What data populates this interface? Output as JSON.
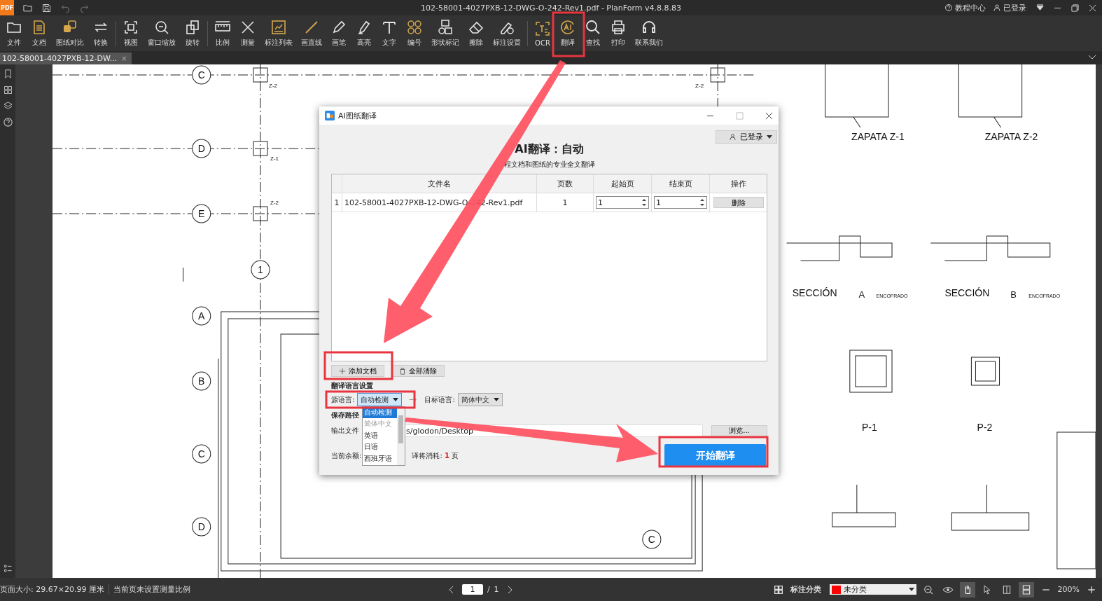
{
  "title_bar": {
    "logo": "PDF",
    "title": "102-58001-4027PXB-12-DWG-O-242-Rev1.pdf - PlanForm v4.8.8.83",
    "links": [
      {
        "label": "教程中心"
      },
      {
        "label": "已登录"
      }
    ]
  },
  "toolbar": {
    "groups": [
      [
        {
          "label": "文件",
          "accent": false
        },
        {
          "label": "文档",
          "accent": true
        },
        {
          "label": "图纸对比",
          "accent": true
        },
        {
          "label": "转换",
          "accent": false
        }
      ],
      [
        {
          "label": "视图",
          "accent": false
        },
        {
          "label": "窗口缩放",
          "accent": false
        },
        {
          "label": "旋转",
          "accent": false
        }
      ],
      [
        {
          "label": "比例",
          "accent": false
        },
        {
          "label": "测量",
          "accent": false
        },
        {
          "label": "标注列表",
          "accent": true
        },
        {
          "label": "画直线",
          "accent": true
        },
        {
          "label": "画笔",
          "accent": false
        },
        {
          "label": "高亮",
          "accent": false
        },
        {
          "label": "文字",
          "accent": false
        },
        {
          "label": "编号",
          "accent": true
        },
        {
          "label": "形状标记",
          "accent": false
        },
        {
          "label": "擦除",
          "accent": false
        },
        {
          "label": "标注设置",
          "accent": false
        }
      ],
      [
        {
          "label": "OCR",
          "accent": true
        },
        {
          "label": "翻译",
          "accent": true
        },
        {
          "label": "查找",
          "accent": false
        },
        {
          "label": "打印",
          "accent": false
        },
        {
          "label": "联系我们",
          "accent": false
        }
      ]
    ]
  },
  "tabs": [
    {
      "label": "102-58001-4027PXB-12-DW...",
      "close": "×",
      "selected": true
    }
  ],
  "drawing": {
    "bubbles": [
      "C",
      "D",
      "E",
      "1",
      "A",
      "B",
      "C",
      "D",
      "C"
    ],
    "labels": [
      "ZAPATA Z-1",
      "ZAPATA Z-2",
      "SECCIÓN",
      "A",
      "ENCOFRADO",
      "SECCIÓN",
      "B",
      "ENCOFRADO",
      "P-1",
      "P-2",
      "Z-2",
      "Z-2",
      "Z-1",
      "Z-2"
    ]
  },
  "dialog": {
    "title": "AI图纸翻译",
    "login": "已登录",
    "heading": "AI翻译：自动",
    "subtitle": "程文档和图纸的专业全文翻译",
    "table": {
      "columns": [
        "文件名",
        "页数",
        "起始页",
        "结束页",
        "操作"
      ],
      "rows": [
        {
          "index": "1",
          "file": "102-58001-4027PXB-12-DWG-O-242-Rev1.pdf",
          "pages": "1",
          "start": "1",
          "end": "1",
          "action": "删除"
        }
      ]
    },
    "add_button": "添加文档",
    "clear_button": "全部清除",
    "lang_section": "翻译语言设置",
    "source_label": "源语言:",
    "source_value": "自动检测",
    "target_label": "目标语言:",
    "target_value": "简体中文",
    "source_options": [
      {
        "label": "自动检测",
        "selected": true,
        "disabled": false
      },
      {
        "label": "简体中文",
        "selected": false,
        "disabled": true
      },
      {
        "label": "英语",
        "selected": false,
        "disabled": false
      },
      {
        "label": "日语",
        "selected": false,
        "disabled": false
      },
      {
        "label": "西班牙语",
        "selected": false,
        "disabled": false
      }
    ],
    "save_section": "保存路径",
    "folder_label": "输出文件",
    "folder_value": "s/glodon/Desktop",
    "browse_button": "浏览...",
    "balance_label": "当前余额:",
    "cost_label": "译将消耗:",
    "cost_value": "1",
    "cost_unit": "页",
    "start_button": "开始翻译"
  },
  "status_bar": {
    "page_size": "页面大小: 29.67×20.99 厘米",
    "scale_note": "当前页未设置测量比例",
    "page_current": "1",
    "page_sep": "/",
    "page_total": "1",
    "category_label": "标注分类",
    "category": {
      "value": "未分类",
      "color": "#ff0000"
    },
    "zoom": "200%"
  }
}
